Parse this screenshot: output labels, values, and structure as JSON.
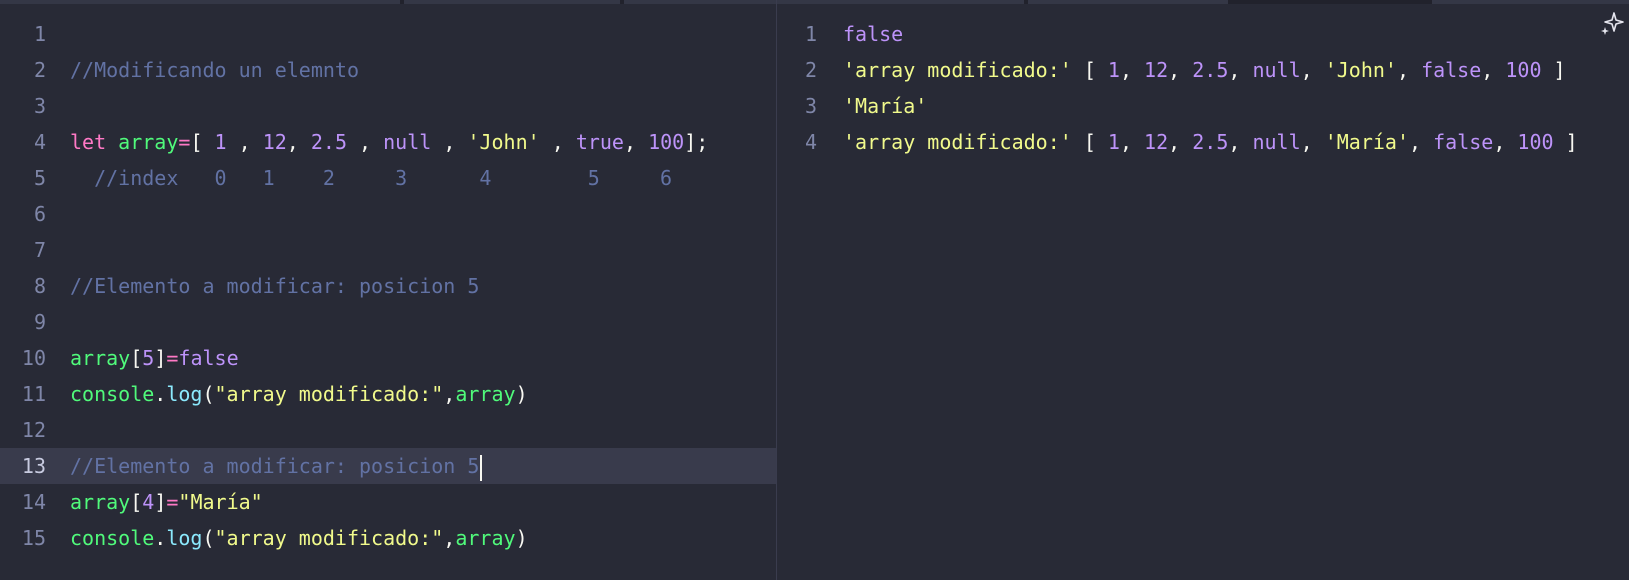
{
  "colors": {
    "background": "#282a36",
    "keyword": "#ff79c6",
    "identifier": "#50fa7b",
    "number": "#bd93f9",
    "string": "#f1fa8c",
    "comment": "#6272a4",
    "function": "#8be9fd"
  },
  "editor": {
    "cursor_line": 13,
    "lines": [
      {
        "n": "1",
        "tokens": []
      },
      {
        "n": "2",
        "tokens": [
          {
            "t": "comment",
            "v": "//Modificando un elemnto"
          }
        ]
      },
      {
        "n": "3",
        "tokens": []
      },
      {
        "n": "4",
        "tokens": [
          {
            "t": "keyword",
            "v": "let"
          },
          {
            "t": "punct",
            "v": " "
          },
          {
            "t": "ident",
            "v": "array"
          },
          {
            "t": "keyword",
            "v": "="
          },
          {
            "t": "punct",
            "v": "[ "
          },
          {
            "t": "num",
            "v": "1"
          },
          {
            "t": "punct",
            "v": " , "
          },
          {
            "t": "num",
            "v": "12"
          },
          {
            "t": "punct",
            "v": ", "
          },
          {
            "t": "num",
            "v": "2.5"
          },
          {
            "t": "punct",
            "v": " , "
          },
          {
            "t": "bool",
            "v": "null"
          },
          {
            "t": "punct",
            "v": " , "
          },
          {
            "t": "str",
            "v": "'John'"
          },
          {
            "t": "punct",
            "v": " , "
          },
          {
            "t": "bool",
            "v": "true"
          },
          {
            "t": "punct",
            "v": ", "
          },
          {
            "t": "num",
            "v": "100"
          },
          {
            "t": "punct",
            "v": "];"
          }
        ]
      },
      {
        "n": "5",
        "tokens": [
          {
            "t": "comment",
            "v": "  //index   0   1    2     3      4        5     6"
          }
        ]
      },
      {
        "n": "6",
        "tokens": []
      },
      {
        "n": "7",
        "tokens": []
      },
      {
        "n": "8",
        "tokens": [
          {
            "t": "comment",
            "v": "//Elemento a modificar: posicion 5"
          }
        ]
      },
      {
        "n": "9",
        "tokens": []
      },
      {
        "n": "10",
        "tokens": [
          {
            "t": "ident",
            "v": "array"
          },
          {
            "t": "punct",
            "v": "["
          },
          {
            "t": "num",
            "v": "5"
          },
          {
            "t": "punct",
            "v": "]"
          },
          {
            "t": "keyword",
            "v": "="
          },
          {
            "t": "bool",
            "v": "false"
          }
        ]
      },
      {
        "n": "11",
        "tokens": [
          {
            "t": "ident",
            "v": "console"
          },
          {
            "t": "punct",
            "v": "."
          },
          {
            "t": "func",
            "v": "log"
          },
          {
            "t": "punct",
            "v": "("
          },
          {
            "t": "str",
            "v": "\"array modificado:\""
          },
          {
            "t": "punct",
            "v": ","
          },
          {
            "t": "ident",
            "v": "array"
          },
          {
            "t": "punct",
            "v": ")"
          }
        ]
      },
      {
        "n": "12",
        "tokens": []
      },
      {
        "n": "13",
        "tokens": [
          {
            "t": "comment",
            "v": "//Elemento a modificar: posicion 5"
          }
        ]
      },
      {
        "n": "14",
        "tokens": [
          {
            "t": "ident",
            "v": "array"
          },
          {
            "t": "punct",
            "v": "["
          },
          {
            "t": "num",
            "v": "4"
          },
          {
            "t": "punct",
            "v": "]"
          },
          {
            "t": "keyword",
            "v": "="
          },
          {
            "t": "str",
            "v": "\"María\""
          }
        ]
      },
      {
        "n": "15",
        "tokens": [
          {
            "t": "ident",
            "v": "console"
          },
          {
            "t": "punct",
            "v": "."
          },
          {
            "t": "func",
            "v": "log"
          },
          {
            "t": "punct",
            "v": "("
          },
          {
            "t": "str",
            "v": "\"array modificado:\""
          },
          {
            "t": "punct",
            "v": ","
          },
          {
            "t": "ident",
            "v": "array"
          },
          {
            "t": "punct",
            "v": ")"
          }
        ]
      }
    ]
  },
  "output": {
    "lines": [
      {
        "n": "1",
        "tokens": [
          {
            "t": "bool",
            "v": "false"
          }
        ]
      },
      {
        "n": "2",
        "tokens": [
          {
            "t": "str",
            "v": "'array modificado:'"
          },
          {
            "t": "punct",
            "v": " [ "
          },
          {
            "t": "num",
            "v": "1"
          },
          {
            "t": "punct",
            "v": ", "
          },
          {
            "t": "num",
            "v": "12"
          },
          {
            "t": "punct",
            "v": ", "
          },
          {
            "t": "num",
            "v": "2.5"
          },
          {
            "t": "punct",
            "v": ", "
          },
          {
            "t": "bool",
            "v": "null"
          },
          {
            "t": "punct",
            "v": ", "
          },
          {
            "t": "str",
            "v": "'John'"
          },
          {
            "t": "punct",
            "v": ", "
          },
          {
            "t": "bool",
            "v": "false"
          },
          {
            "t": "punct",
            "v": ", "
          },
          {
            "t": "num",
            "v": "100"
          },
          {
            "t": "punct",
            "v": " ]"
          }
        ]
      },
      {
        "n": "3",
        "tokens": [
          {
            "t": "str",
            "v": "'María'"
          }
        ]
      },
      {
        "n": "4",
        "tokens": [
          {
            "t": "str",
            "v": "'array modificado:'"
          },
          {
            "t": "punct",
            "v": " [ "
          },
          {
            "t": "num",
            "v": "1"
          },
          {
            "t": "punct",
            "v": ", "
          },
          {
            "t": "num",
            "v": "12"
          },
          {
            "t": "punct",
            "v": ", "
          },
          {
            "t": "num",
            "v": "2.5"
          },
          {
            "t": "punct",
            "v": ", "
          },
          {
            "t": "bool",
            "v": "null"
          },
          {
            "t": "punct",
            "v": ", "
          },
          {
            "t": "str",
            "v": "'María'"
          },
          {
            "t": "punct",
            "v": ", "
          },
          {
            "t": "bool",
            "v": "false"
          },
          {
            "t": "punct",
            "v": ", "
          },
          {
            "t": "num",
            "v": "100"
          },
          {
            "t": "punct",
            "v": " ]"
          }
        ]
      }
    ]
  },
  "icons": {
    "corner": "sparkle-icon"
  }
}
